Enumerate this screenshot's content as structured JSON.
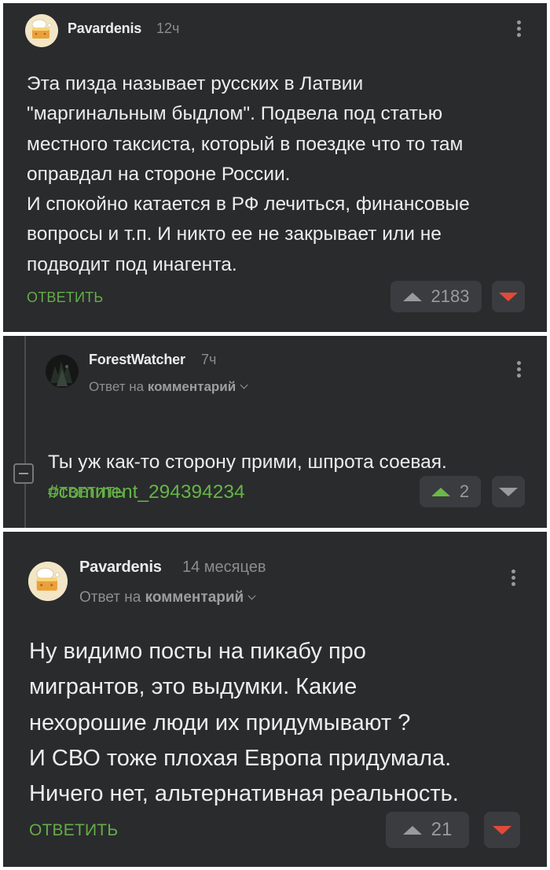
{
  "comments": [
    {
      "author": "Pavardenis",
      "time": "12ч",
      "text": "Эта пизда называет русских в Латвии\n\"маргинальным быдлом\". Подвела под статью\nместного таксиста, который в поездке что то там\nоправдал на стороне России.\nИ спокойно катается в РФ лечиться, финансовые\nвопросы и т.п. И никто ее не закрывает или не\nподводит под инагента.",
      "reply_label": "ОТВЕТИТЬ",
      "rating": "2183",
      "vote": "down"
    },
    {
      "author": "ForestWatcher",
      "time": "7ч",
      "reply_to_prefix": "Ответ на",
      "reply_to_target": "комментарий",
      "text": "Ты уж как-то сторону прими, шпрота соевая.",
      "link": "#comment_294394234",
      "reply_label": "ОТВЕТИТЬ",
      "rating": "2",
      "vote": "up"
    },
    {
      "author": "Pavardenis",
      "time": "14 месяцев",
      "reply_to_prefix": "Ответ на",
      "reply_to_target": "комментарий",
      "text": "Ну видимо посты на пикабу про\nмигрантов, это выдумки.  Какие\nнехорошие люди их придумывают ?\nИ СВО тоже плохая Европа придумала.\nНичего нет, альтернативная реальность.",
      "reply_label": "ОТВЕТИТЬ",
      "rating": "21",
      "vote": "down"
    }
  ],
  "colors": {
    "background": "#2a2b2d",
    "accent_green": "#64ad48",
    "downvote_red": "#e04a3a"
  },
  "icons": [
    "cake-avatar",
    "forest-avatar",
    "kebab-menu-icon",
    "upvote-icon",
    "downvote-icon",
    "collapse-thread-icon",
    "chevron-down-icon"
  ]
}
